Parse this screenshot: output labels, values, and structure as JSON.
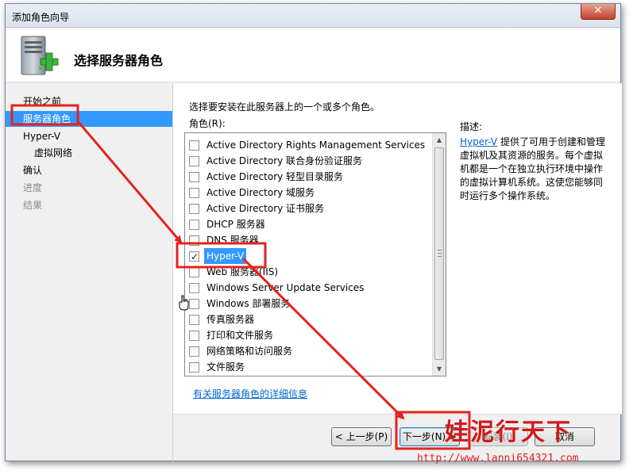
{
  "window": {
    "title": "添加角色向导",
    "close_label": "✕",
    "page_title": "选择服务器角色"
  },
  "nav": {
    "items": [
      {
        "label": "开始之前",
        "state": "normal"
      },
      {
        "label": "服务器角色",
        "state": "selected"
      },
      {
        "label": "Hyper-V",
        "state": "normal"
      },
      {
        "label": "虚拟网络",
        "state": "sub"
      },
      {
        "label": "确认",
        "state": "normal"
      },
      {
        "label": "进度",
        "state": "disabled"
      },
      {
        "label": "结果",
        "state": "disabled"
      }
    ]
  },
  "content": {
    "instruction": "选择要安装在此服务器上的一个或多个角色。",
    "roles_label": "角色(R):",
    "roles": [
      {
        "label": "Active Directory Rights Management Services",
        "checked": false
      },
      {
        "label": "Active Directory 联合身份验证服务",
        "checked": false
      },
      {
        "label": "Active Directory 轻型目录服务",
        "checked": false
      },
      {
        "label": "Active Directory 域服务",
        "checked": false
      },
      {
        "label": "Active Directory 证书服务",
        "checked": false
      },
      {
        "label": "DHCP 服务器",
        "checked": false
      },
      {
        "label": "DNS 服务器",
        "checked": false
      },
      {
        "label": "Hyper-V",
        "checked": true
      },
      {
        "label": "Web 服务器(IIS)",
        "checked": false
      },
      {
        "label": "Windows Server Update Services",
        "checked": false
      },
      {
        "label": "Windows 部署服务",
        "checked": false
      },
      {
        "label": "传真服务器",
        "checked": false
      },
      {
        "label": "打印和文件服务",
        "checked": false
      },
      {
        "label": "网络策略和访问服务",
        "checked": false
      },
      {
        "label": "文件服务",
        "checked": false
      }
    ],
    "description_label": "描述:",
    "description_link": "Hyper-V",
    "description_text": " 提供了可用于创建和管理虚拟机及其资源的服务。每个虚拟机都是一个在独立执行环境中操作的虚拟计算机系统。这使您能够同时运行多个操作系统。",
    "more_info_link": "有关服务器角色的详细信息"
  },
  "buttons": {
    "prev": "< 上一步(P)",
    "next": "下一步(N) >",
    "install": "安装(I)",
    "cancel": "取消"
  },
  "watermark": {
    "text": "娃泥行天下",
    "url": "http://www.lanni654321.com"
  },
  "colors": {
    "selection": "#3399ff",
    "annotation": "#e3231e",
    "link": "#0066cc"
  }
}
